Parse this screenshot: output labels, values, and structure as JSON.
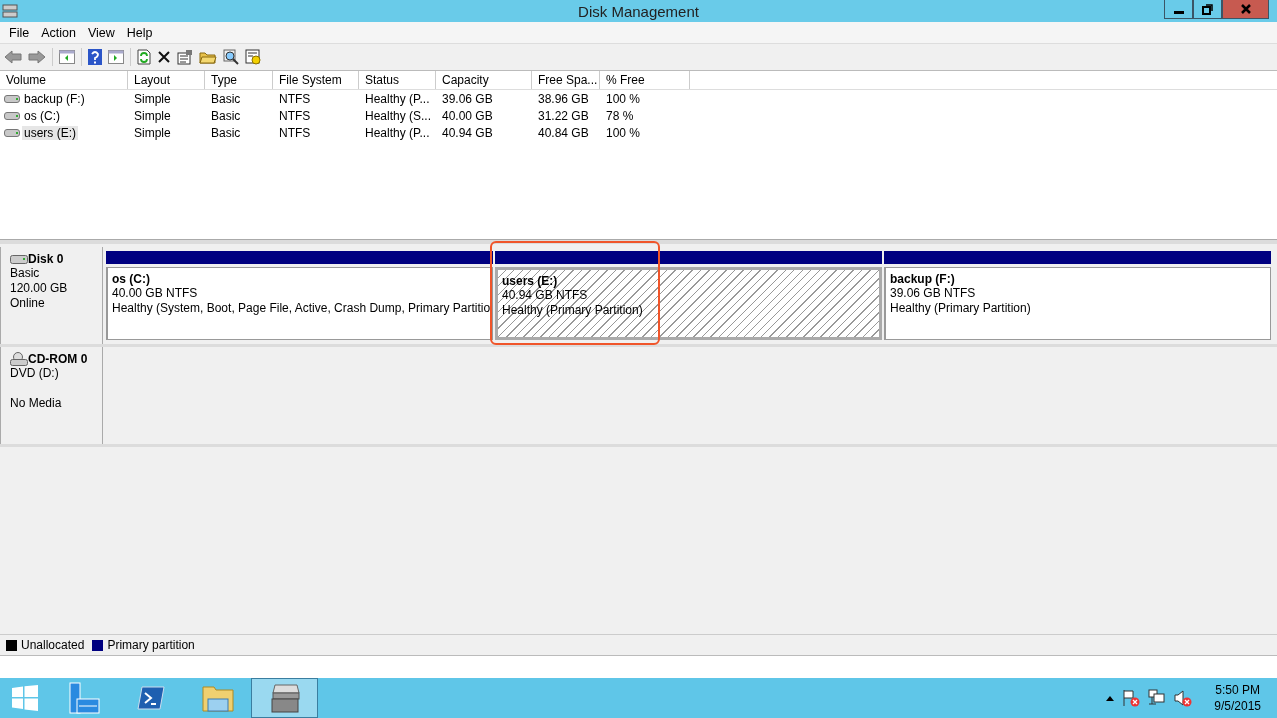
{
  "window": {
    "title": "Disk Management"
  },
  "menu": [
    "File",
    "Action",
    "View",
    "Help"
  ],
  "volume_table": {
    "columns": [
      "Volume",
      "Layout",
      "Type",
      "File System",
      "Status",
      "Capacity",
      "Free Spa...",
      "% Free"
    ],
    "rows": [
      {
        "selected": false,
        "cells": [
          "backup (F:)",
          "Simple",
          "Basic",
          "NTFS",
          "Healthy (P...",
          "39.06 GB",
          "38.96 GB",
          "100 %"
        ]
      },
      {
        "selected": false,
        "cells": [
          "os (C:)",
          "Simple",
          "Basic",
          "NTFS",
          "Healthy (S...",
          "40.00 GB",
          "31.22 GB",
          "78 %"
        ]
      },
      {
        "selected": true,
        "cells": [
          "users (E:)",
          "Simple",
          "Basic",
          "NTFS",
          "Healthy (P...",
          "40.94 GB",
          "40.84 GB",
          "100 %"
        ]
      }
    ]
  },
  "disks": [
    {
      "kind": "disk",
      "name": "Disk 0",
      "lines": [
        "Basic",
        "120.00 GB",
        "Online"
      ],
      "partitions": [
        {
          "name": "os  (C:)",
          "size": "40.00 GB NTFS",
          "status": "Healthy (System, Boot, Page File, Active, Crash Dump, Primary Partitio",
          "selected": false
        },
        {
          "name": "users  (E:)",
          "size": "40.94 GB NTFS",
          "status": "Healthy (Primary Partition)",
          "selected": true
        },
        {
          "name": "backup  (F:)",
          "size": "39.06 GB NTFS",
          "status": "Healthy (Primary Partition)",
          "selected": false
        }
      ]
    },
    {
      "kind": "cdrom",
      "name": "CD-ROM 0",
      "lines": [
        "DVD (D:)",
        "No Media"
      ]
    }
  ],
  "legend": [
    {
      "label": "Unallocated",
      "color": "#000000"
    },
    {
      "label": "Primary partition",
      "color": "#000080"
    }
  ],
  "taskbar": {
    "apps": [
      {
        "kind": "server",
        "selected": false
      },
      {
        "kind": "shell",
        "selected": false
      },
      {
        "kind": "folder",
        "selected": false
      },
      {
        "kind": "disk",
        "selected": true
      }
    ],
    "time": "5:50 PM",
    "date": "9/5/2015"
  }
}
